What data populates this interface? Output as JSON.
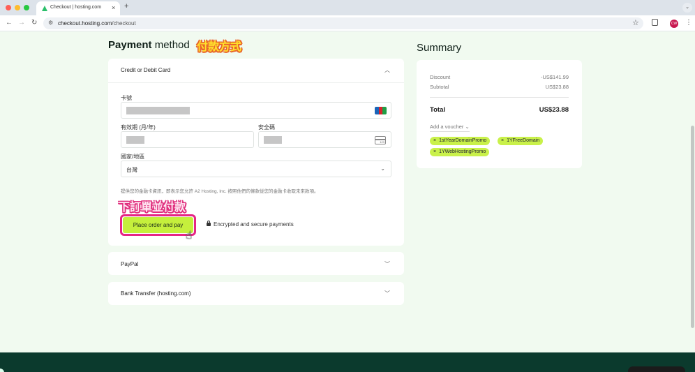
{
  "browser": {
    "tab_title": "Checkout | hosting.com",
    "tab_close": "×",
    "new_tab": "+",
    "url_host": "checkout.hosting.com",
    "url_path": "/checkout",
    "profile_initials": "CW"
  },
  "payment": {
    "heading_bold": "Payment",
    "heading_rest": " method",
    "annotation": "付款方式",
    "card_section_title": "Credit or Debit Card",
    "card_number_label": "卡號",
    "expiry_label": "有效期 (月/年)",
    "cvc_label": "安全碼",
    "cvc_icon_text": "123",
    "country_label": "國家/地區",
    "country_value": "台灣",
    "consent_text": "提供您的金融卡資訊，即表示您允許 A2 Hosting, Inc. 按照他們的條款從您的金融卡收取未來款項。",
    "order_annotation": "下訂單並付款",
    "order_button": "Place order and pay",
    "secure_text": "Encrypted and secure payments",
    "paypal_title": "PayPal",
    "bank_title": "Bank Transfer (hosting.com)"
  },
  "summary": {
    "title": "Summary",
    "discount_label": "Discount",
    "discount_value": "-US$141.99",
    "subtotal_label": "Subtotal",
    "subtotal_value": "US$23.88",
    "total_label": "Total",
    "total_value": "US$23.88",
    "voucher_link": "Add a voucher",
    "promos": [
      "1stYearDomainPromo",
      "1YFreeDomain",
      "1YWebHostingPromo"
    ]
  },
  "colors": {
    "accent_green": "#c5ef3c",
    "promo_chip": "#c9f14a",
    "annotation_pink": "#e62585",
    "footer": "#0b3a2d"
  }
}
